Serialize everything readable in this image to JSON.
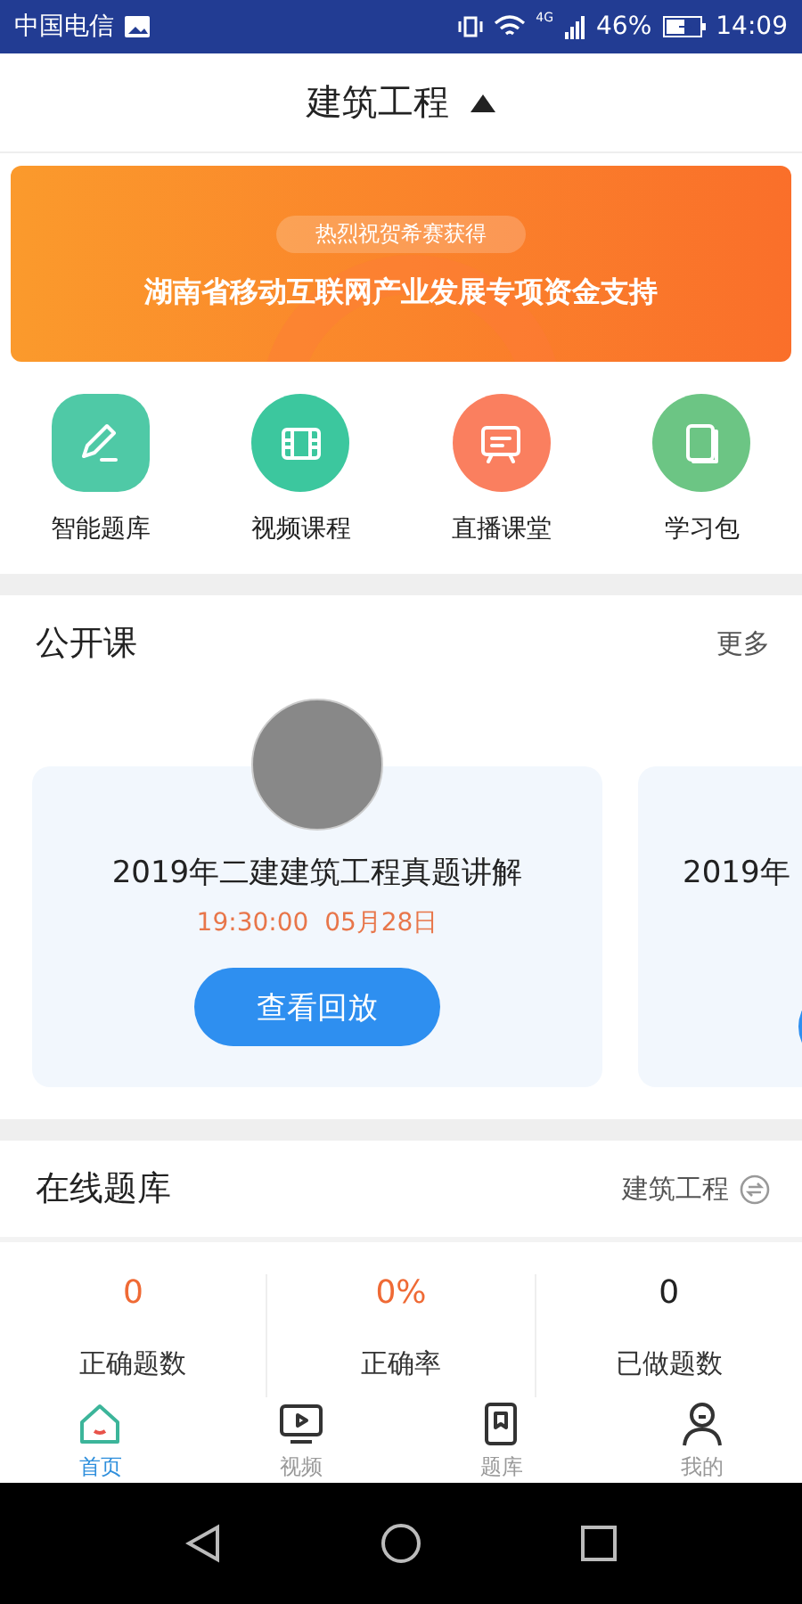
{
  "status_bar": {
    "carrier": "中国电信",
    "network": "4G",
    "battery": "46%",
    "time": "14:09"
  },
  "header": {
    "title": "建筑工程",
    "expanded": true
  },
  "banner": {
    "tag": "热烈祝贺希赛获得",
    "headline": "湖南省移动互联网产业发展专项资金支持"
  },
  "shortcuts": [
    {
      "label": "智能题库",
      "kind": "pencil",
      "color": "#4fc9a6"
    },
    {
      "label": "视频课程",
      "kind": "film",
      "color": "#3cc79e"
    },
    {
      "label": "直播课堂",
      "kind": "board",
      "color": "#fa7f5f"
    },
    {
      "label": "学习包",
      "kind": "book",
      "color": "#6cc584"
    }
  ],
  "open_courses": {
    "title": "公开课",
    "more": "更多",
    "cards": [
      {
        "title": "2019年二建建筑工程真题讲解",
        "time": "19:30:00  05月28日",
        "button": "查看回放"
      },
      {
        "title": "2019年"
      }
    ]
  },
  "question_bank": {
    "title": "在线题库",
    "subject": "建筑工程",
    "stats": [
      {
        "value": "0",
        "label": "正确题数",
        "highlight": true
      },
      {
        "value": "0%",
        "label": "正确率",
        "highlight": true
      },
      {
        "value": "0",
        "label": "已做题数",
        "highlight": false
      }
    ]
  },
  "tab_bar": [
    {
      "label": "首页",
      "kind": "home",
      "selected": true
    },
    {
      "label": "视频",
      "kind": "video",
      "selected": false
    },
    {
      "label": "题库",
      "kind": "bank",
      "selected": false
    },
    {
      "label": "我的",
      "kind": "profile",
      "selected": false
    }
  ]
}
